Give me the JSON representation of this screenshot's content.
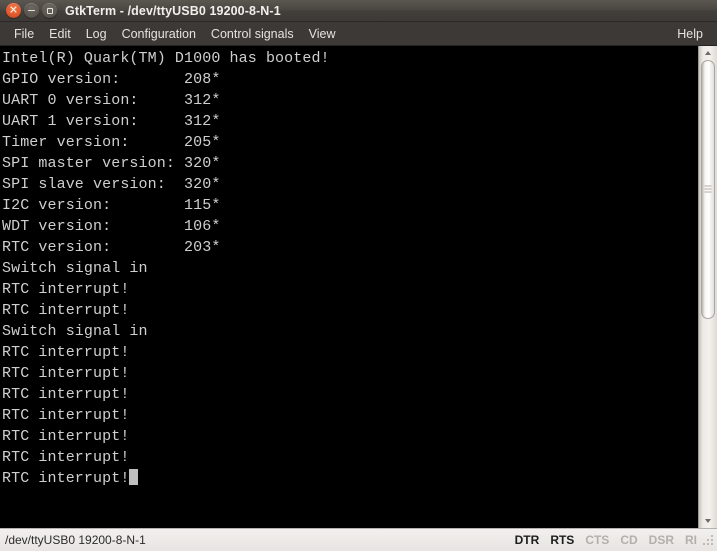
{
  "window": {
    "title": "GtkTerm - /dev/ttyUSB0  19200-8-N-1",
    "buttons": {
      "close": "×",
      "minimize": "minimize",
      "maximize": "maximize"
    }
  },
  "menubar": {
    "items": [
      {
        "label": "File"
      },
      {
        "label": "Edit"
      },
      {
        "label": "Log"
      },
      {
        "label": "Configuration"
      },
      {
        "label": "Control signals"
      },
      {
        "label": "View"
      }
    ],
    "help": "Help"
  },
  "terminal": {
    "background": "#000000",
    "foreground": "#cfcfcf",
    "cursor_color": "#bfbfbf",
    "lines": [
      "Intel(R) Quark(TM) D1000 has booted!",
      "GPIO version:       208*",
      "UART 0 version:     312*",
      "UART 1 version:     312*",
      "Timer version:      205*",
      "SPI master version: 320*",
      "SPI slave version:  320*",
      "I2C version:        115*",
      "WDT version:        106*",
      "RTC version:        203*",
      "Switch signal in",
      "RTC interrupt!",
      "RTC interrupt!",
      "Switch signal in",
      "RTC interrupt!",
      "RTC interrupt!",
      "RTC interrupt!",
      "RTC interrupt!",
      "RTC interrupt!",
      "RTC interrupt!",
      "RTC interrupt!"
    ],
    "last_line": "RTC interrupt!"
  },
  "scrollbar": {
    "thumb_top_percent": 0,
    "thumb_height_percent": 57
  },
  "statusbar": {
    "port_info": "/dev/ttyUSB0 19200-8-N-1",
    "signals": [
      {
        "label": "DTR",
        "active": true
      },
      {
        "label": "RTS",
        "active": true
      },
      {
        "label": "CTS",
        "active": false
      },
      {
        "label": "CD",
        "active": false
      },
      {
        "label": "DSR",
        "active": false
      },
      {
        "label": "RI",
        "active": false
      }
    ]
  }
}
